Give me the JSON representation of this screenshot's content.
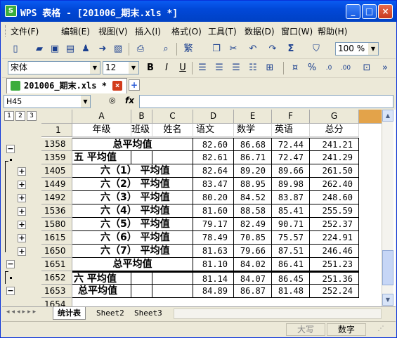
{
  "window": {
    "app_icon": "S",
    "title": "WPS 表格 - [201006_期末.xls *]",
    "minimize": "_",
    "maximize": "□",
    "close": "×"
  },
  "menu": [
    "文件(F)",
    "编辑(E)",
    "视图(V)",
    "插入(I)",
    "格式(O)",
    "工具(T)",
    "数据(D)",
    "窗口(W)",
    "帮助(H)"
  ],
  "toolbar": {
    "zoom": "100 %",
    "font_name": "宋体",
    "font_size": "12",
    "bold": "B",
    "italic": "I",
    "underline": "U",
    "traditional": "繁",
    "sum": "Σ",
    "currency": "%",
    "format_comma": "%",
    "decimal_add": ".0",
    "decimal_remove": ".00"
  },
  "doc_tab": {
    "label": "201006_期末.xls *",
    "close": "×",
    "new": "+"
  },
  "formula_bar": {
    "name_box": "H45",
    "fx": "fx",
    "value": ""
  },
  "outline_levels": [
    "1",
    "2",
    "3"
  ],
  "columns": [
    "A",
    "B",
    "C",
    "D",
    "E",
    "F",
    "G"
  ],
  "rows": [
    {
      "num": "1",
      "a": "年级",
      "b": "班级",
      "c": "姓名",
      "d": "语文",
      "e": "数学",
      "f": "英语",
      "g": "总分"
    },
    {
      "num": "1358",
      "label": "总平均值",
      "d": "82.60",
      "e": "86.68",
      "f": "72.44",
      "g": "241.21"
    },
    {
      "num": "1359",
      "label": "五 平均值",
      "d": "82.61",
      "e": "86.71",
      "f": "72.47",
      "g": "241.29"
    },
    {
      "num": "1405",
      "label": "六（1） 平均值",
      "d": "82.64",
      "e": "89.20",
      "f": "89.66",
      "g": "261.50"
    },
    {
      "num": "1449",
      "label": "六（2） 平均值",
      "d": "83.47",
      "e": "88.95",
      "f": "89.98",
      "g": "262.40"
    },
    {
      "num": "1492",
      "label": "六（3） 平均值",
      "d": "80.20",
      "e": "84.52",
      "f": "83.87",
      "g": "248.60"
    },
    {
      "num": "1536",
      "label": "六（4） 平均值",
      "d": "81.60",
      "e": "88.58",
      "f": "85.41",
      "g": "255.59"
    },
    {
      "num": "1580",
      "label": "六（5） 平均值",
      "d": "79.17",
      "e": "82.49",
      "f": "90.71",
      "g": "252.37"
    },
    {
      "num": "1615",
      "label": "六（6） 平均值",
      "d": "78.49",
      "e": "70.85",
      "f": "75.57",
      "g": "224.91"
    },
    {
      "num": "1650",
      "label": "六（7） 平均值",
      "d": "81.63",
      "e": "79.66",
      "f": "87.51",
      "g": "246.46"
    },
    {
      "num": "1651",
      "label": "总平均值",
      "d": "81.10",
      "e": "84.02",
      "f": "86.41",
      "g": "251.23"
    },
    {
      "num": "1652",
      "label": "六 平均值",
      "d": "81.14",
      "e": "84.07",
      "f": "86.45",
      "g": "251.36"
    },
    {
      "num": "1653",
      "label": "总平均值",
      "d": "84.89",
      "e": "86.87",
      "f": "81.48",
      "g": "252.24"
    },
    {
      "num": "1654",
      "label": "",
      "d": "",
      "e": "",
      "f": "",
      "g": ""
    }
  ],
  "sheet_tabs": [
    "统计表",
    "Sheet2",
    "Sheet3"
  ],
  "status": {
    "caps": "大写",
    "num": "数字"
  }
}
